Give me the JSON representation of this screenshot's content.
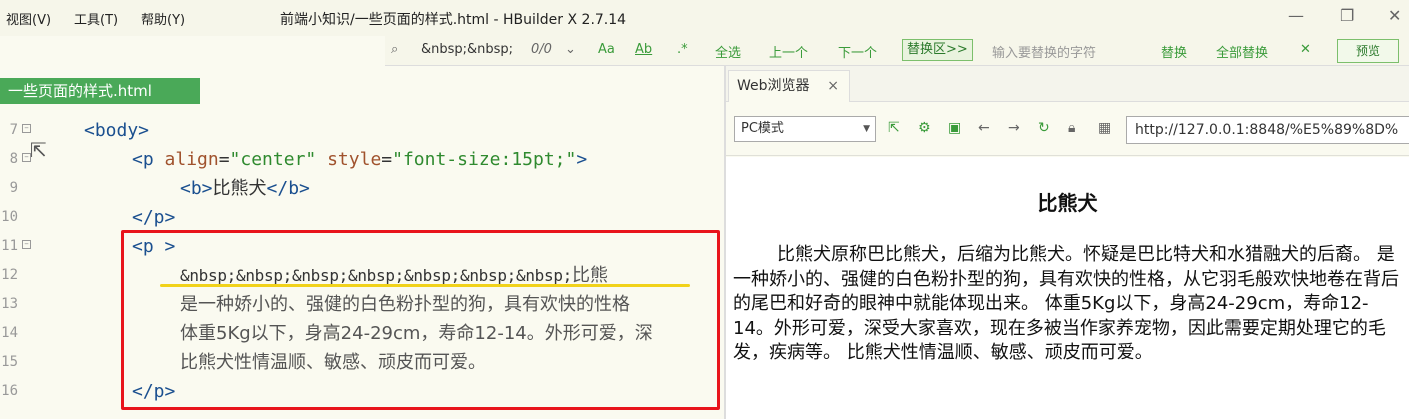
{
  "menu": {
    "view": "视图(V)",
    "tools": "工具(T)",
    "help": "帮助(Y)"
  },
  "window_title": "前端小知识/一些页面的样式.html - HBuilder X 2.7.14",
  "findbar": {
    "search_value": "&nbsp;&nbsp;",
    "match_count": "0/0",
    "case_label": "Aa",
    "word_label": "Ab",
    "regex_label": ".*",
    "select_all": "全选",
    "prev": "上一个",
    "next": "下一个",
    "replace_area": "替换区>>",
    "replace_placeholder": "输入要替换的字符",
    "replace": "替换",
    "replace_all": "全部替换",
    "close": "✕",
    "preview": "预览"
  },
  "editor": {
    "tab_label": "一些页面的样式.html",
    "lines": [
      {
        "num": "7"
      },
      {
        "num": "8"
      },
      {
        "num": "9"
      },
      {
        "num": "10"
      },
      {
        "num": "11"
      },
      {
        "num": "12"
      },
      {
        "num": "13"
      },
      {
        "num": "14"
      },
      {
        "num": "15"
      },
      {
        "num": "16"
      }
    ],
    "l7_tag": "<body>",
    "l8_open": "<p ",
    "l8_attr1": "align",
    "l8_eq1": "=",
    "l8_val1": "\"center\"",
    "l8_attr2": "style",
    "l8_eq2": "=",
    "l8_val2": "\"font-size:15pt;\"",
    "l8_close": ">",
    "l9_open": "<b>",
    "l9_text": "比熊犬",
    "l9_close": "</b>",
    "l10_tag": "</p>",
    "l11_tag": "<p >",
    "l12_entities": "&nbsp;&nbsp;&nbsp;&nbsp;&nbsp;&nbsp;&nbsp;",
    "l12_text": "比熊",
    "l13_text": "是一种娇小的、强健的白色粉扑型的狗，具有欢快的性格",
    "l14_text": "体重5Kg以下，身高24-29cm，寿命12-14。外形可爱，深",
    "l15_text": "比熊犬性情温顺、敏感、顽皮而可爱。",
    "l16_tag": "</p>"
  },
  "browser": {
    "tab_label": "Web浏览器",
    "tab_close": "×",
    "mode": "PC模式",
    "url": "http://127.0.0.1:8848/%E5%89%8D%",
    "heading": "比熊犬",
    "paragraph": "比熊犬原称巴比熊犬，后缩为比熊犬。怀疑是巴比特犬和水猎融犬的后裔。 是一种娇小的、强健的白色粉扑型的狗，具有欢快的性格，从它羽毛般欢快地卷在背后的尾巴和好奇的眼神中就能体现出来。 体重5Kg以下，身高24-29cm，寿命12-14。外形可爱，深受大家喜欢，现在多被当作家养宠物，因此需要定期处理它的毛发，疾病等。 比熊犬性情温顺、敏感、顽皮而可爱。"
  },
  "colors": {
    "accent_green": "#4aa958",
    "highlight_red": "#e8141b",
    "underline_yellow": "#f1d21a"
  }
}
